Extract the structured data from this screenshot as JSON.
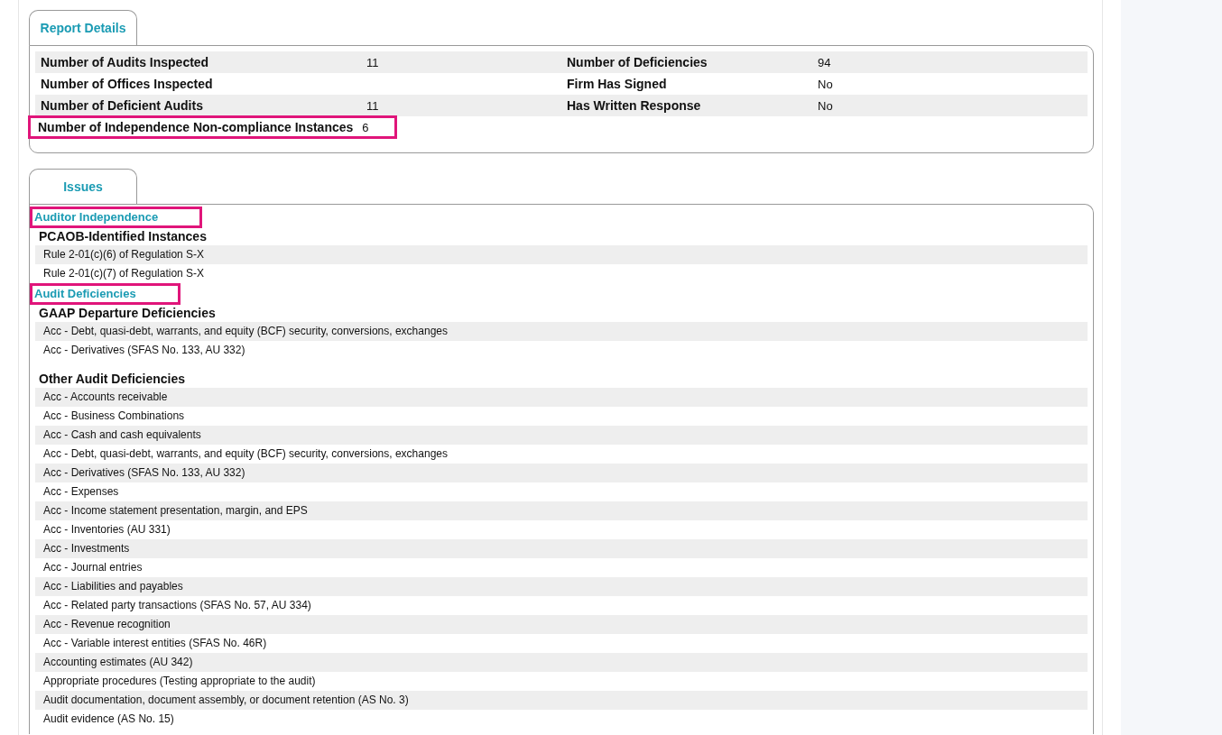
{
  "report_details": {
    "tab": "Report Details",
    "rows": [
      {
        "left": {
          "label": "Number of Audits Inspected",
          "value": "11",
          "highlighted": false
        },
        "right": {
          "label": "Number of Deficiencies",
          "value": "94"
        }
      },
      {
        "left": {
          "label": "Number of Offices Inspected",
          "highlighted": false
        },
        "right": {
          "label": "Firm Has Signed",
          "value": "No"
        }
      },
      {
        "left": {
          "label": "Number of Deficient Audits",
          "value": "11",
          "highlighted": false
        },
        "right": {
          "label": "Has Written Response",
          "value": "No"
        }
      },
      {
        "left": {
          "label": "Number of Independence Non-compliance Instances",
          "value": "6",
          "highlighted": true
        }
      }
    ]
  },
  "issues": {
    "tab": "Issues",
    "sections": [
      {
        "heading": "Auditor Independence",
        "highlighted": true,
        "groups": [
          {
            "title": "PCAOB-Identified Instances",
            "items": [
              "Rule 2-01(c)(6) of Regulation S-X",
              "Rule 2-01(c)(7) of Regulation S-X"
            ]
          }
        ]
      },
      {
        "heading": "Audit Deficiencies",
        "highlighted": true,
        "groups": [
          {
            "title": "GAAP Departure Deficiencies",
            "items": [
              "Acc - Debt, quasi-debt, warrants, and equity (BCF) security, conversions, exchanges",
              "Acc - Derivatives (SFAS No. 133, AU 332)"
            ]
          },
          {
            "title": "Other Audit Deficiencies",
            "items": [
              "Acc - Accounts receivable",
              "Acc - Business Combinations",
              "Acc - Cash and cash equivalents",
              "Acc - Debt, quasi-debt, warrants, and equity (BCF) security, conversions, exchanges",
              "Acc - Derivatives (SFAS No. 133, AU 332)",
              "Acc - Expenses",
              "Acc - Income statement presentation, margin, and EPS",
              "Acc - Inventories (AU 331)",
              "Acc - Investments",
              "Acc - Journal entries",
              "Acc - Liabilities and payables",
              "Acc - Related party transactions (SFAS No. 57, AU 334)",
              "Acc - Revenue recognition",
              "Acc - Variable interest entities (SFAS No. 46R)",
              "Accounting estimates (AU 342)",
              "Appropriate procedures (Testing appropriate to the audit)",
              "Audit documentation, document assembly, or document retention (AS No. 3)",
              "Audit evidence (AS No. 15)"
            ]
          }
        ]
      }
    ]
  }
}
